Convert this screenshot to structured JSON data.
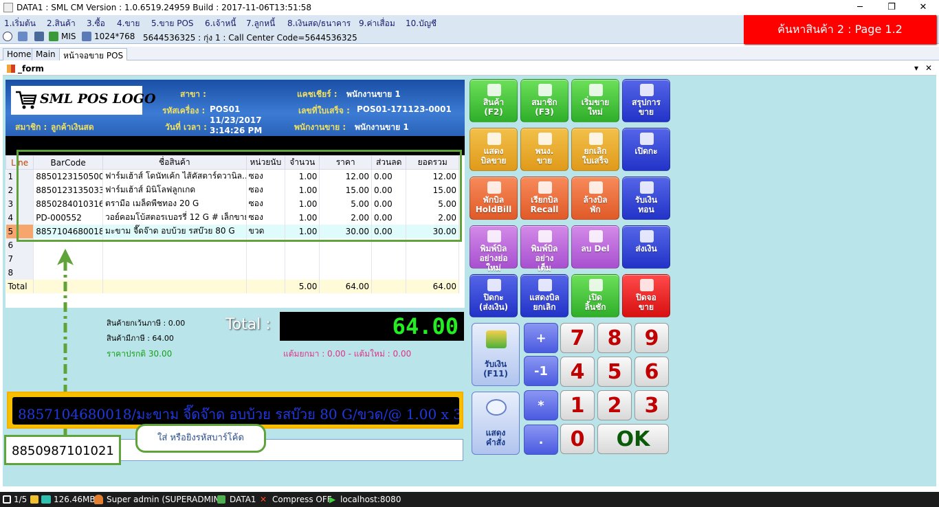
{
  "titlebar": {
    "title": "DATA1 : SML CM Version : 1.0.6519.24959  Build : 2017-11-06T13:51:58",
    "minimize": "─",
    "restore": "❐",
    "close": "✕"
  },
  "menu": [
    "1.เริ่มต้น",
    "2.สินค้า",
    "3.ซื้อ",
    "4.ขาย",
    "5.ขาย POS",
    "6.เจ้าหนี้",
    "7.ลูกหนี้",
    "8.เงินสด/ธนาคาร",
    "9.ค่าเสื่อม",
    "10.บัญชี"
  ],
  "toolbar": {
    "mis": "MIS",
    "resolution": "1024*768",
    "info": "5644536325 : กุ่ง 1 : Call Center Code=5644536325"
  },
  "banner": "ค้นหาสินค้า 2 : Page 1.2",
  "tabs": [
    "Home",
    "Main",
    "หน้าจอขาย POS"
  ],
  "form": {
    "title": "_form",
    "pin": "▾",
    "close": "✕"
  },
  "header": {
    "logo": "SML POS LOGO",
    "branch_label": "สาขา :",
    "machine_label": "รหัสเครื่อง :",
    "machine_value": "POS01",
    "datetime_label": "วันที่ เวลา :",
    "date_value": "11/23/2017",
    "time_value": "3:14:26 PM",
    "member_label": "สมาชิก :",
    "member_value": "ลูกค้าเงินสด",
    "cashier_label": "แคชเชียร์ :",
    "cashier_value": "พนักงานขาย 1",
    "receipt_label": "เลขที่ใบเสร็จ :",
    "receipt_value": "POS01-171123-0001",
    "sales_label": "พนักงานขาย :",
    "sales_value": "พนักงานขาย 1"
  },
  "grid": {
    "columns": [
      "Line",
      "BarCode",
      "ชื่อสินค้า",
      "หน่วยนับ",
      "จำนวน",
      "ราคา",
      "ส่วนลด",
      "ยอดรวม"
    ],
    "rows": [
      [
        "1",
        "8850123150500",
        "ฟาร์มเฮ้าส์ โดนัทเค้ก ไส้คัสตาร์ดวานิล..",
        "ซอง",
        "1.00",
        "12.00",
        "0.00",
        "12.00"
      ],
      [
        "2",
        "8850123135033",
        "ฟาร์มเฮ้าส์ มินิโลฟลูกเกด",
        "ซอง",
        "1.00",
        "15.00",
        "0.00",
        "15.00"
      ],
      [
        "3",
        "8850284010316",
        "ตรามือ เมล็ดพืชทอง 20 G",
        "ซอง",
        "1.00",
        "5.00",
        "0.00",
        "5.00"
      ],
      [
        "4",
        "PD-000552",
        "วอย์คอมโบ้สตอรเบอรรี่ 12 G # เล็กขาย",
        "ซอง",
        "1.00",
        "2.00",
        "0.00",
        "2.00"
      ],
      [
        "5",
        "8857104680018",
        "มะขาม จี๊ดจ๊าด อบบ้วย รสบ๊วย 80 G",
        "ขวด",
        "1.00",
        "30.00",
        "0.00",
        "30.00"
      ],
      [
        "6",
        "",
        "",
        "",
        "",
        "",
        "",
        ""
      ],
      [
        "7",
        "",
        "",
        "",
        "",
        "",
        "",
        ""
      ],
      [
        "8",
        "",
        "",
        "",
        "",
        "",
        "",
        ""
      ]
    ],
    "total_label": "Total",
    "total_qty": "5.00",
    "total_price": "64.00",
    "total_sum": "64.00"
  },
  "summary": {
    "exempt_label": "สินค้ายกเว้นภาษี : 0.00",
    "vat_label": "สินค้ามีภาษี : 64.00",
    "normal_price": "ราคาปรกติ 30.00",
    "points": "แต้มยกมา : 0.00 - แต้มใหม่ : 0.00",
    "total_label": "Total :",
    "total_value": "64.00"
  },
  "marquee": "8857104680018/มะขาม จี๊ดจ๊าด อบบ้วย รสบ๊วย 80 G/ขวด/@ 1.00 x 3",
  "input": {
    "barcode_value": "8850987101021",
    "hint": "ใส่ หรือยิงรหัสบาร์โค้ด"
  },
  "buttons": [
    {
      "label": "สินค้า\n(F2)",
      "style": "g"
    },
    {
      "label": "สมาชิก\n(F3)",
      "style": "g"
    },
    {
      "label": "เริ่มขาย\nใหม่",
      "style": "g"
    },
    {
      "label": "สรุปการ\nขาย",
      "style": "b"
    },
    {
      "label": "แสดง\nบิลขาย",
      "style": "o"
    },
    {
      "label": "พนง.\nขาย",
      "style": "o"
    },
    {
      "label": "ยกเลิก\nใบเสร็จ",
      "style": "o"
    },
    {
      "label": "เปิดกะ",
      "style": "b"
    },
    {
      "label": "พักบิล\nHoldBill",
      "style": "r"
    },
    {
      "label": "เรียกบิล\nRecall",
      "style": "r"
    },
    {
      "label": "ล้างบิล\nพัก",
      "style": "r"
    },
    {
      "label": "รับเงิน\nทอน",
      "style": "b"
    },
    {
      "label": "พิมพ์บิล\nอย่างย่อ\nใหม่",
      "style": "p"
    },
    {
      "label": "พิมพ์บิล\nอย่าง\nเต็ม",
      "style": "p"
    },
    {
      "label": "ลบ Del",
      "style": "p"
    },
    {
      "label": "ส่งเงิน",
      "style": "b"
    },
    {
      "label": "ปิดกะ\n(ส่งเงิน)",
      "style": "b"
    },
    {
      "label": "แสดงบิล\nยกเลิก",
      "style": "b"
    },
    {
      "label": "เปิด\nลิ้นชัก",
      "style": "g"
    },
    {
      "label": "ปิดจอ\nขาย",
      "style": "red"
    }
  ],
  "keypad": {
    "receive": "รับเงิน\n(F11)",
    "show_order": "แสดง\nคำสั่ง",
    "plus": "+",
    "minus": "-1",
    "mult": "*",
    "dot": ".",
    "digits": [
      "7",
      "8",
      "9",
      "4",
      "5",
      "6",
      "1",
      "2",
      "3",
      "0"
    ],
    "ok": "OK"
  },
  "status": {
    "page": "1/5",
    "memory": "126.46MB",
    "user": "Super admin (SUPERADMIN)",
    "db": "DATA1",
    "compress": "Compress OFF",
    "host": "localhost:8080"
  }
}
